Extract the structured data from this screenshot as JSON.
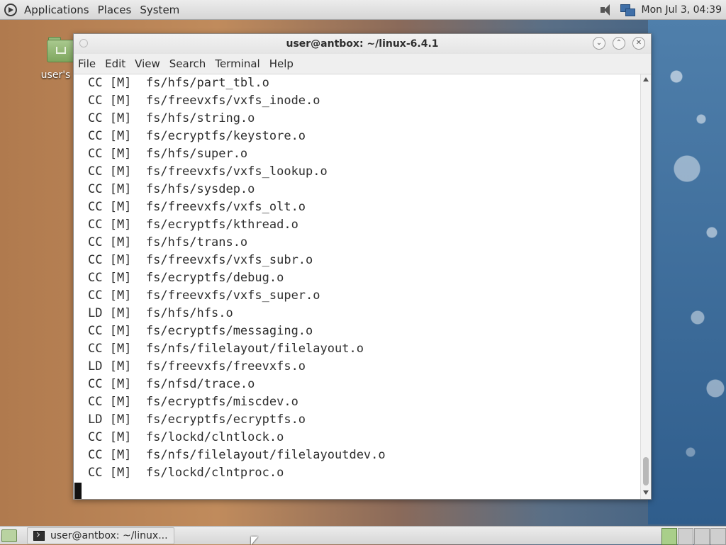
{
  "top_panel": {
    "menus": [
      "Applications",
      "Places",
      "System"
    ],
    "clock": "Mon Jul 3, 04:39"
  },
  "desktop": {
    "icon_label": "user's H"
  },
  "window": {
    "title": "user@antbox: ~/linux-6.4.1",
    "menubar": [
      "File",
      "Edit",
      "View",
      "Search",
      "Terminal",
      "Help"
    ],
    "lines": [
      "CC [M]  fs/hfs/part_tbl.o",
      "CC [M]  fs/freevxfs/vxfs_inode.o",
      "CC [M]  fs/hfs/string.o",
      "CC [M]  fs/ecryptfs/keystore.o",
      "CC [M]  fs/hfs/super.o",
      "CC [M]  fs/freevxfs/vxfs_lookup.o",
      "CC [M]  fs/hfs/sysdep.o",
      "CC [M]  fs/freevxfs/vxfs_olt.o",
      "CC [M]  fs/ecryptfs/kthread.o",
      "CC [M]  fs/hfs/trans.o",
      "CC [M]  fs/freevxfs/vxfs_subr.o",
      "CC [M]  fs/ecryptfs/debug.o",
      "CC [M]  fs/freevxfs/vxfs_super.o",
      "LD [M]  fs/hfs/hfs.o",
      "CC [M]  fs/ecryptfs/messaging.o",
      "CC [M]  fs/nfs/filelayout/filelayout.o",
      "LD [M]  fs/freevxfs/freevxfs.o",
      "CC [M]  fs/nfsd/trace.o",
      "CC [M]  fs/ecryptfs/miscdev.o",
      "LD [M]  fs/ecryptfs/ecryptfs.o",
      "CC [M]  fs/lockd/clntlock.o",
      "CC [M]  fs/nfs/filelayout/filelayoutdev.o",
      "CC [M]  fs/lockd/clntproc.o"
    ]
  },
  "taskbar": {
    "task_label": "user@antbox: ~/linux..."
  }
}
